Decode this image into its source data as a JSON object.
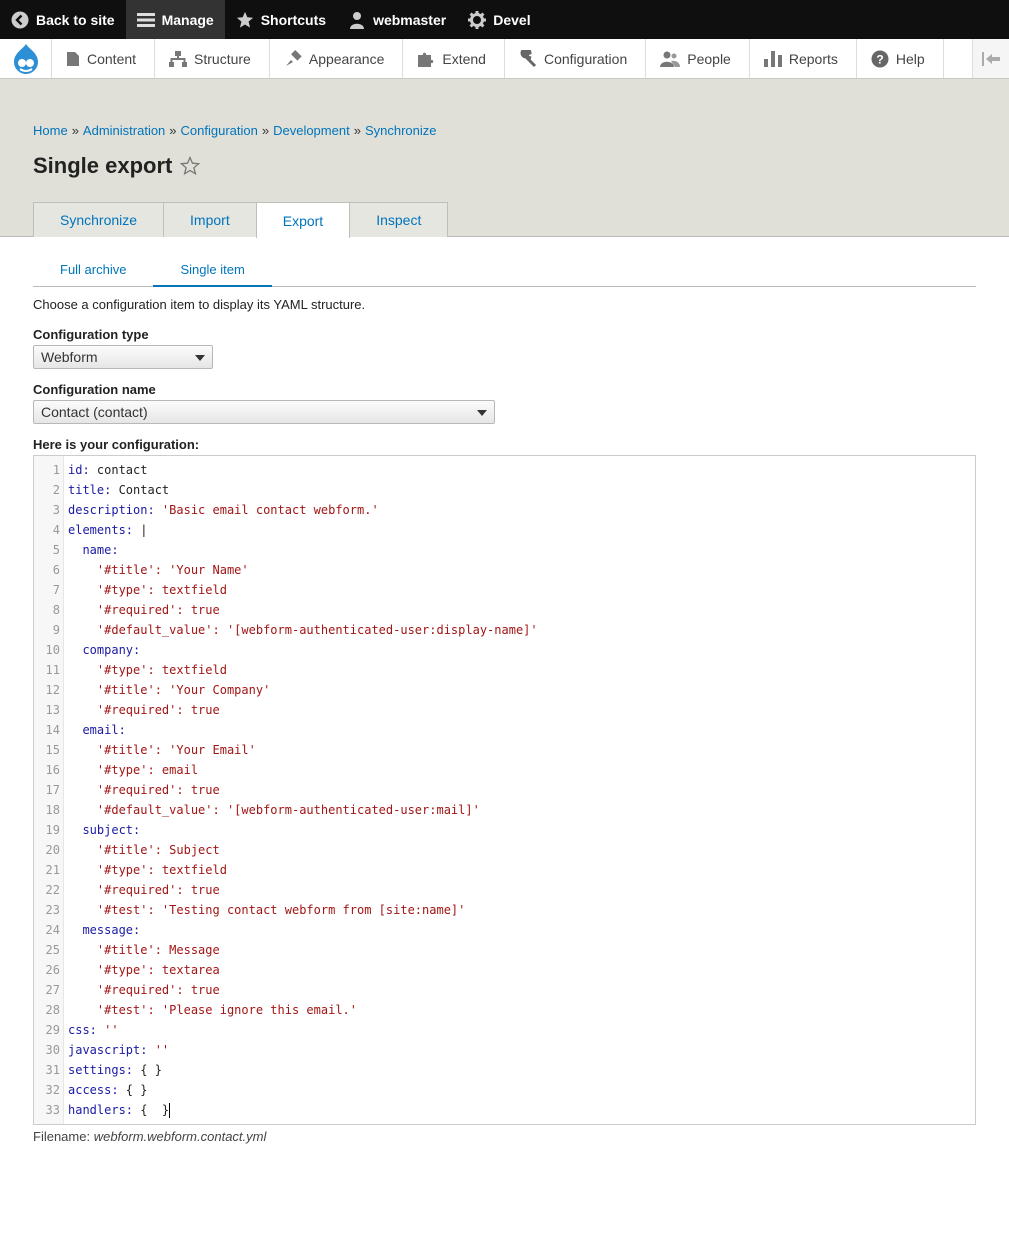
{
  "toolbar": {
    "back_to_site": "Back to site",
    "manage": "Manage",
    "shortcuts": "Shortcuts",
    "user": "webmaster",
    "devel": "Devel"
  },
  "tray": {
    "items": [
      "Content",
      "Structure",
      "Appearance",
      "Extend",
      "Configuration",
      "People",
      "Reports",
      "Help"
    ]
  },
  "breadcrumb": [
    "Home",
    "Administration",
    "Configuration",
    "Development",
    "Synchronize"
  ],
  "page_title": "Single export",
  "tabs": [
    "Synchronize",
    "Import",
    "Export",
    "Inspect"
  ],
  "subtabs": [
    "Full archive",
    "Single item"
  ],
  "description": "Choose a configuration item to display its YAML structure.",
  "config_type": {
    "label": "Configuration type",
    "value": "Webform"
  },
  "config_name": {
    "label": "Configuration name",
    "value": "Contact (contact)"
  },
  "config_label": "Here is your configuration:",
  "code_lines": [
    {
      "indent": "",
      "key": "id",
      "value": "contact",
      "type": "plain"
    },
    {
      "indent": "",
      "key": "title",
      "value": "Contact",
      "type": "plain"
    },
    {
      "indent": "",
      "key": "description",
      "value": "'Basic email contact webform.'",
      "type": "string"
    },
    {
      "indent": "",
      "key": "elements",
      "value": "|",
      "type": "plain"
    },
    {
      "indent": "  ",
      "key": "name",
      "value": "",
      "type": "plain"
    },
    {
      "indent": "    ",
      "key": "'#title'",
      "value": "'Your Name'",
      "type": "string"
    },
    {
      "indent": "    ",
      "key": "'#type'",
      "value": "textfield",
      "type": "string"
    },
    {
      "indent": "    ",
      "key": "'#required'",
      "value": "true",
      "type": "string"
    },
    {
      "indent": "    ",
      "key": "'#default_value'",
      "value": "'[webform-authenticated-user:display-name]'",
      "type": "string"
    },
    {
      "indent": "  ",
      "key": "company",
      "value": "",
      "type": "plain"
    },
    {
      "indent": "    ",
      "key": "'#type'",
      "value": "textfield",
      "type": "string"
    },
    {
      "indent": "    ",
      "key": "'#title'",
      "value": "'Your Company'",
      "type": "string"
    },
    {
      "indent": "    ",
      "key": "'#required'",
      "value": "true",
      "type": "string"
    },
    {
      "indent": "  ",
      "key": "email",
      "value": "",
      "type": "plain"
    },
    {
      "indent": "    ",
      "key": "'#title'",
      "value": "'Your Email'",
      "type": "string"
    },
    {
      "indent": "    ",
      "key": "'#type'",
      "value": "email",
      "type": "string"
    },
    {
      "indent": "    ",
      "key": "'#required'",
      "value": "true",
      "type": "string"
    },
    {
      "indent": "    ",
      "key": "'#default_value'",
      "value": "'[webform-authenticated-user:mail]'",
      "type": "string"
    },
    {
      "indent": "  ",
      "key": "subject",
      "value": "",
      "type": "plain"
    },
    {
      "indent": "    ",
      "key": "'#title'",
      "value": "Subject",
      "type": "string"
    },
    {
      "indent": "    ",
      "key": "'#type'",
      "value": "textfield",
      "type": "string"
    },
    {
      "indent": "    ",
      "key": "'#required'",
      "value": "true",
      "type": "string"
    },
    {
      "indent": "    ",
      "key": "'#test'",
      "value": "'Testing contact webform from [site:name]'",
      "type": "string"
    },
    {
      "indent": "  ",
      "key": "message",
      "value": "",
      "type": "plain"
    },
    {
      "indent": "    ",
      "key": "'#title'",
      "value": "Message",
      "type": "string"
    },
    {
      "indent": "    ",
      "key": "'#type'",
      "value": "textarea",
      "type": "string"
    },
    {
      "indent": "    ",
      "key": "'#required'",
      "value": "true",
      "type": "string"
    },
    {
      "indent": "    ",
      "key": "'#test'",
      "value": "'Please ignore this email.'",
      "type": "string"
    },
    {
      "indent": "",
      "key": "css",
      "value": "''",
      "type": "string"
    },
    {
      "indent": "",
      "key": "javascript",
      "value": "''",
      "type": "string"
    },
    {
      "indent": "",
      "key": "settings",
      "value": "{ }",
      "type": "plain"
    },
    {
      "indent": "",
      "key": "access",
      "value": "{ }",
      "type": "plain"
    },
    {
      "indent": "",
      "key": "handlers",
      "value": "{  }",
      "type": "plain"
    }
  ],
  "filename_label": "Filename:",
  "filename": "webform.webform.contact.yml"
}
